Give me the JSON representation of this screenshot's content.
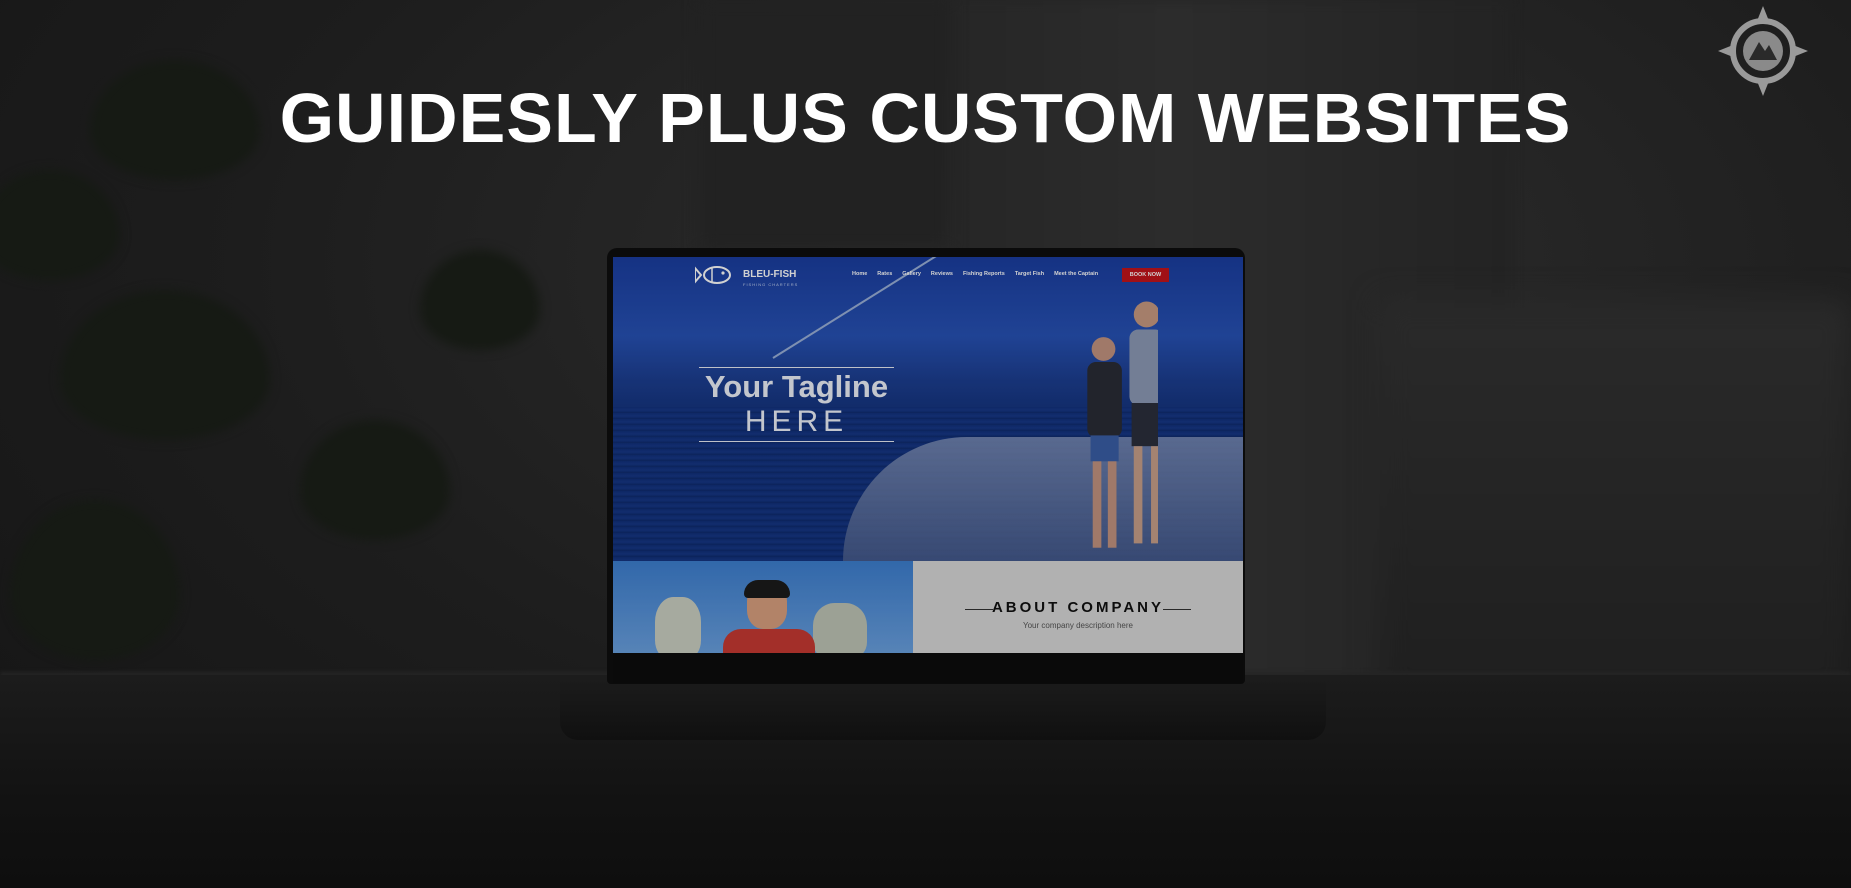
{
  "title": "GUIDESLY PLUS CUSTOM WEBSITES",
  "badge_icon": "compass-mountain-logo-icon",
  "website": {
    "brand": "BLEU-FISH",
    "brand_subtitle": "FISHING CHARTERS",
    "nav": [
      "Home",
      "Rates",
      "Gallery",
      "Reviews",
      "Fishing Reports",
      "Target Fish",
      "Meet the Captain"
    ],
    "book_button": "BOOK NOW",
    "tagline_line1": "Your Tagline",
    "tagline_line2": "HERE",
    "about_title": "ABOUT COMPANY",
    "about_desc": "Your company description here",
    "accent_color": "#c4141c"
  }
}
